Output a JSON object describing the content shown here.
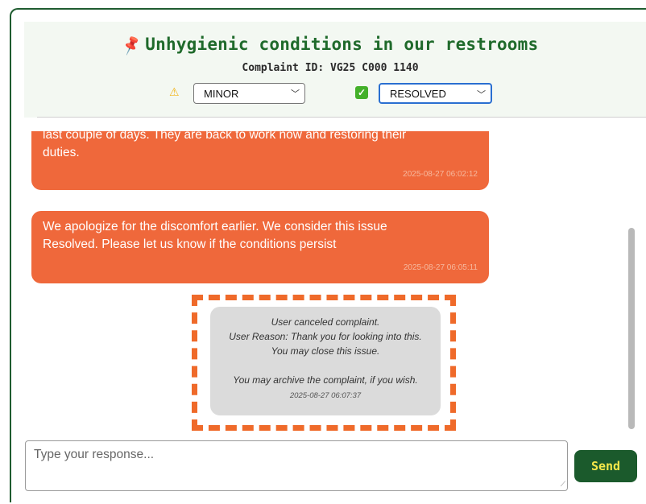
{
  "header": {
    "title": "Unhygienic conditions in our restrooms",
    "complaint_id": "Complaint ID: VG25 C000 1140",
    "severity_select": {
      "selected": "MINOR"
    },
    "status_select": {
      "selected": "RESOLVED"
    },
    "icons": {
      "title": "pin-icon",
      "severity": "warning-icon",
      "status": "check-icon"
    }
  },
  "messages": [
    {
      "lines": [
        "last couple of days. They are back to work now and restoring their",
        "duties."
      ],
      "timestamp": "2025-08-27 06:02:12"
    },
    {
      "lines": [
        "We apologize for the discomfort earlier. We consider this issue",
        "Resolved. Please let us know if the conditions persist"
      ],
      "timestamp": "2025-08-27 06:05:11"
    }
  ],
  "system_message": {
    "line1": "User canceled complaint.",
    "line2": "User Reason: Thank you for looking into this.",
    "line3": "You may close this issue.",
    "line4": "You may archive the complaint, if you wish.",
    "timestamp": "2025-08-27 06:07:37"
  },
  "composer": {
    "placeholder": "Type your response...",
    "send_label": "Send"
  },
  "colors": {
    "brand_green": "#1f6a2b",
    "bubble_orange": "#ef683b",
    "highlight_dash": "#ef6a2a",
    "send_text": "#f5e84a"
  }
}
